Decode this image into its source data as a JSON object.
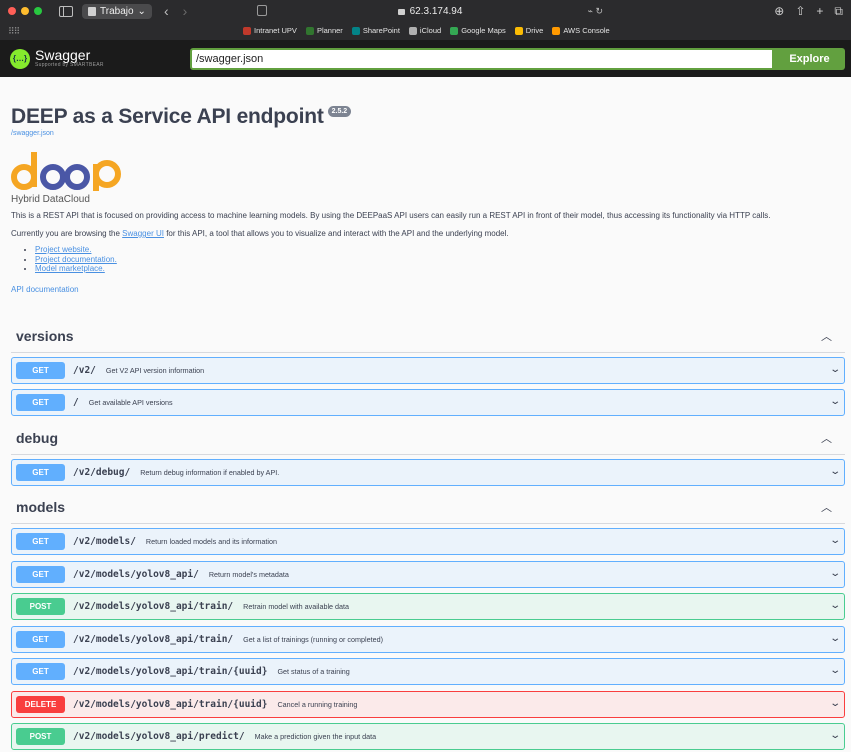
{
  "browser": {
    "tab_group_label": "Trabajo",
    "url": "62.3.174.94",
    "favorites": [
      {
        "label": "Intranet UPV",
        "color": "#c0392b"
      },
      {
        "label": "Planner",
        "color": "#31752f"
      },
      {
        "label": "SharePoint",
        "color": "#038387"
      },
      {
        "label": "iCloud",
        "color": "#b0b0b0"
      },
      {
        "label": "Google Maps",
        "color": "#34a853"
      },
      {
        "label": "Drive",
        "color": "#fbbc04"
      },
      {
        "label": "AWS Console",
        "color": "#ff9900"
      }
    ]
  },
  "topbar": {
    "brand": "Swagger",
    "brand_sub": "Supported by SMARTBEAR",
    "spec_url": "/swagger.json",
    "explore_label": "Explore"
  },
  "info": {
    "title": "DEEP as a Service API endpoint",
    "version": "2.5.2",
    "spec_link": "/swagger.json",
    "logo_sub": "Hybrid DataCloud",
    "description": "This is a REST API that is focused on providing access to machine learning models. By using the DEEPaaS API users can easily run a REST API in front of their model, thus accessing its functionality via HTTP calls.",
    "browsing_pre": "Currently you are browsing the ",
    "browsing_link": "Swagger UI",
    "browsing_post": " for this API, a tool that allows you to visualize and interact with the API and the underlying model.",
    "links": [
      "Project website.",
      "Project documentation.",
      "Model marketplace."
    ],
    "api_doc": "API documentation"
  },
  "groups": [
    {
      "name": "versions",
      "ops": [
        {
          "method": "GET",
          "path": "/v2/",
          "summary": "Get V2 API version information"
        },
        {
          "method": "GET",
          "path": "/",
          "summary": "Get available API versions"
        }
      ]
    },
    {
      "name": "debug",
      "ops": [
        {
          "method": "GET",
          "path": "/v2/debug/",
          "summary": "Return debug information if enabled by API."
        }
      ]
    },
    {
      "name": "models",
      "ops": [
        {
          "method": "GET",
          "path": "/v2/models/",
          "summary": "Return loaded models and its information"
        },
        {
          "method": "GET",
          "path": "/v2/models/yolov8_api/",
          "summary": "Return model's metadata"
        },
        {
          "method": "POST",
          "path": "/v2/models/yolov8_api/train/",
          "summary": "Retrain model with available data"
        },
        {
          "method": "GET",
          "path": "/v2/models/yolov8_api/train/",
          "summary": "Get a list of trainings (running or completed)"
        },
        {
          "method": "GET",
          "path": "/v2/models/yolov8_api/train/{uuid}",
          "summary": "Get status of a training"
        },
        {
          "method": "DELETE",
          "path": "/v2/models/yolov8_api/train/{uuid}",
          "summary": "Cancel a running training"
        },
        {
          "method": "POST",
          "path": "/v2/models/yolov8_api/predict/",
          "summary": "Make a prediction given the input data"
        }
      ]
    }
  ],
  "colors": {
    "get": "#61affe",
    "post": "#49cc90",
    "delete": "#f93e3e",
    "swagger_green": "#62a03f",
    "deep_orange": "#f5a623",
    "deep_blue": "#4a57a6"
  }
}
